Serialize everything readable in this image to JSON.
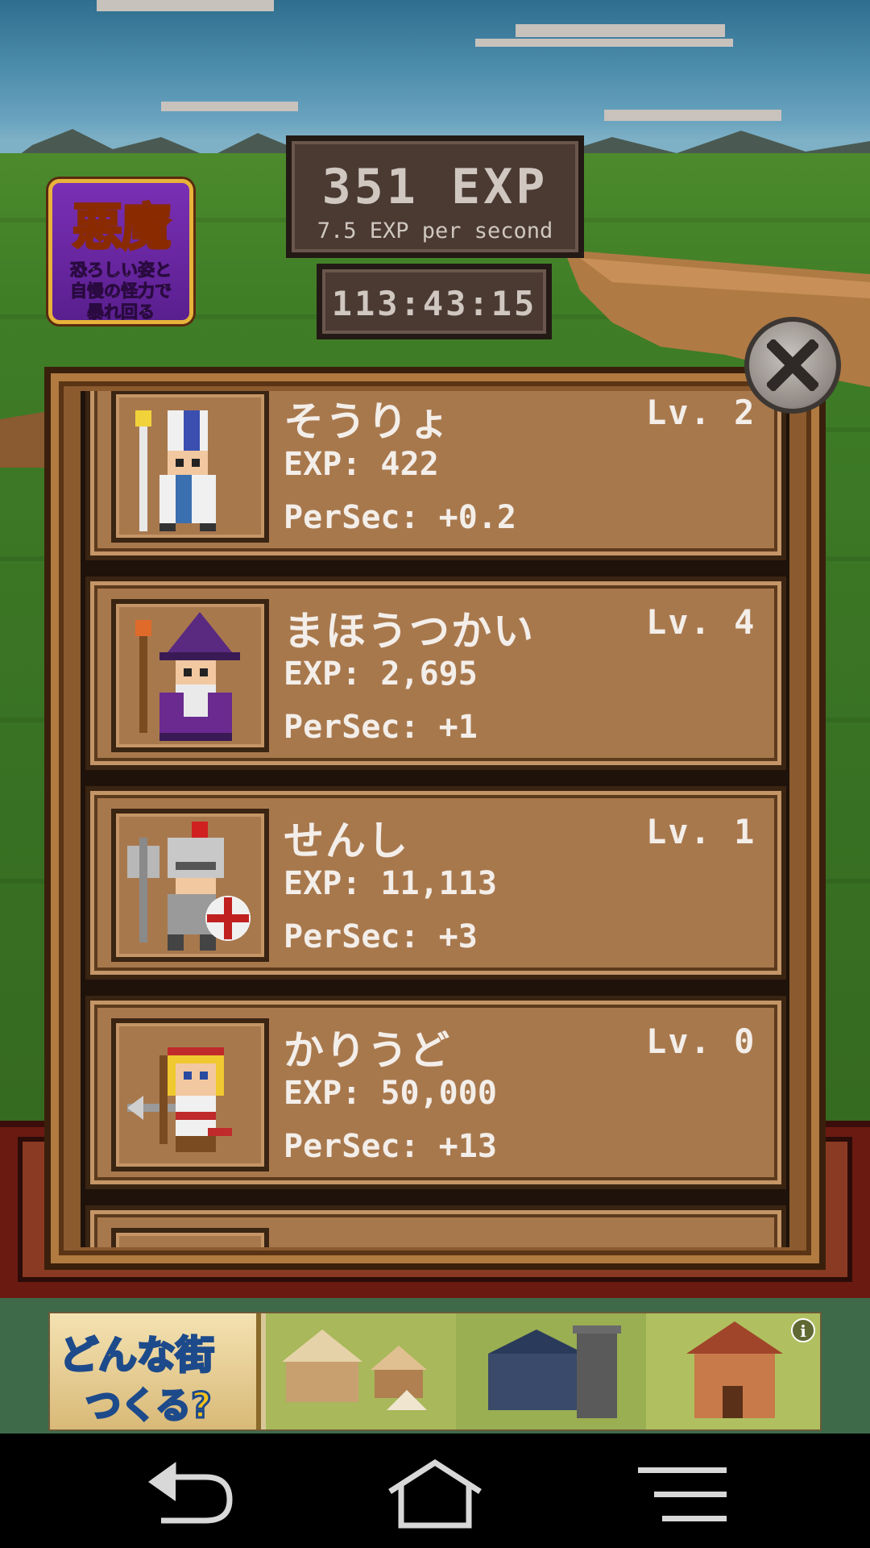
{
  "hud": {
    "exp_total": "351 EXP",
    "exp_rate": "7.5 EXP per second",
    "timer": "113:43:15"
  },
  "promo": {
    "title": "悪魔",
    "lines": [
      "恐ろしい姿と",
      "自慢の怪力で",
      "暴れ回る"
    ]
  },
  "units": [
    {
      "name": "そうりょ",
      "level": "Lv. 2",
      "exp": "EXP: 422",
      "per_sec": "PerSec: +0.2",
      "icon": "priest-icon"
    },
    {
      "name": "まほうつかい",
      "level": "Lv. 4",
      "exp": "EXP: 2,695",
      "per_sec": "PerSec: +1",
      "icon": "wizard-icon"
    },
    {
      "name": "せんし",
      "level": "Lv. 1",
      "exp": "EXP: 11,113",
      "per_sec": "PerSec: +3",
      "icon": "warrior-icon"
    },
    {
      "name": "かりうど",
      "level": "Lv. 0",
      "exp": "EXP: 50,000",
      "per_sec": "PerSec: +13",
      "icon": "hunter-icon"
    }
  ],
  "ad": {
    "title_line1": "どんな街",
    "title_line2": "つくる?",
    "info": "i"
  },
  "colors": {
    "panel_wood": "#a8784d",
    "hud_bg": "#4a3a32",
    "text_light": "#f3eee9"
  }
}
